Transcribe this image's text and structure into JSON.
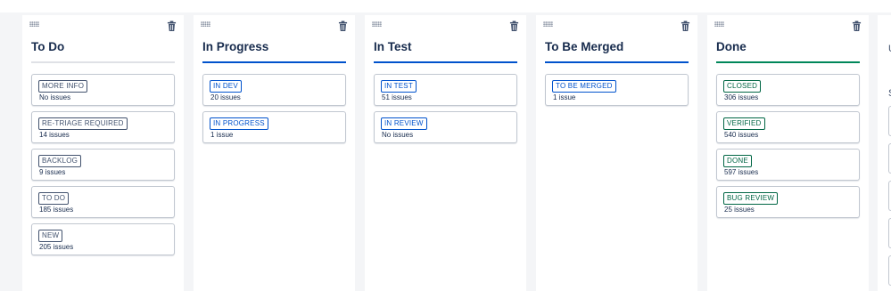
{
  "colors": {
    "neutral_bar": "#dfe1e6",
    "blue_bar": "#0052cc",
    "green_bar": "#00875a",
    "neutral_lozenge": "#42526e",
    "blue_lozenge": "#0052cc",
    "green_lozenge": "#006644"
  },
  "columns": [
    {
      "title": "To Do",
      "bar_color": "#dfe1e6",
      "statuses": [
        {
          "label": "MORE INFO",
          "count": "No issues",
          "tone": "neutral"
        },
        {
          "label": "RE-TRIAGE REQUIRED",
          "count": "14 issues",
          "tone": "neutral"
        },
        {
          "label": "BACKLOG",
          "count": "9 issues",
          "tone": "neutral"
        },
        {
          "label": "TO DO",
          "count": "185 issues",
          "tone": "neutral"
        },
        {
          "label": "NEW",
          "count": "205 issues",
          "tone": "neutral"
        }
      ]
    },
    {
      "title": "In Progress",
      "bar_color": "#0052cc",
      "statuses": [
        {
          "label": "IN DEV",
          "count": "20 issues",
          "tone": "blue"
        },
        {
          "label": "IN PROGRESS",
          "count": "1 issue",
          "tone": "blue"
        }
      ]
    },
    {
      "title": "In Test",
      "bar_color": "#0052cc",
      "statuses": [
        {
          "label": "IN TEST",
          "count": "51 issues",
          "tone": "blue"
        },
        {
          "label": "IN REVIEW",
          "count": "No issues",
          "tone": "blue"
        }
      ]
    },
    {
      "title": "To Be Merged",
      "bar_color": "#0052cc",
      "statuses": [
        {
          "label": "TO BE MERGED",
          "count": "1 issue",
          "tone": "blue"
        }
      ]
    },
    {
      "title": "Done",
      "bar_color": "#00875a",
      "statuses": [
        {
          "label": "CLOSED",
          "count": "306 issues",
          "tone": "green"
        },
        {
          "label": "VERIFIED",
          "count": "540 issues",
          "tone": "green"
        },
        {
          "label": "DONE",
          "count": "597 issues",
          "tone": "green"
        },
        {
          "label": "BUG REVIEW",
          "count": "25 issues",
          "tone": "green"
        }
      ]
    }
  ],
  "side_panel": {
    "text_1": "U",
    "text_2": "S"
  }
}
